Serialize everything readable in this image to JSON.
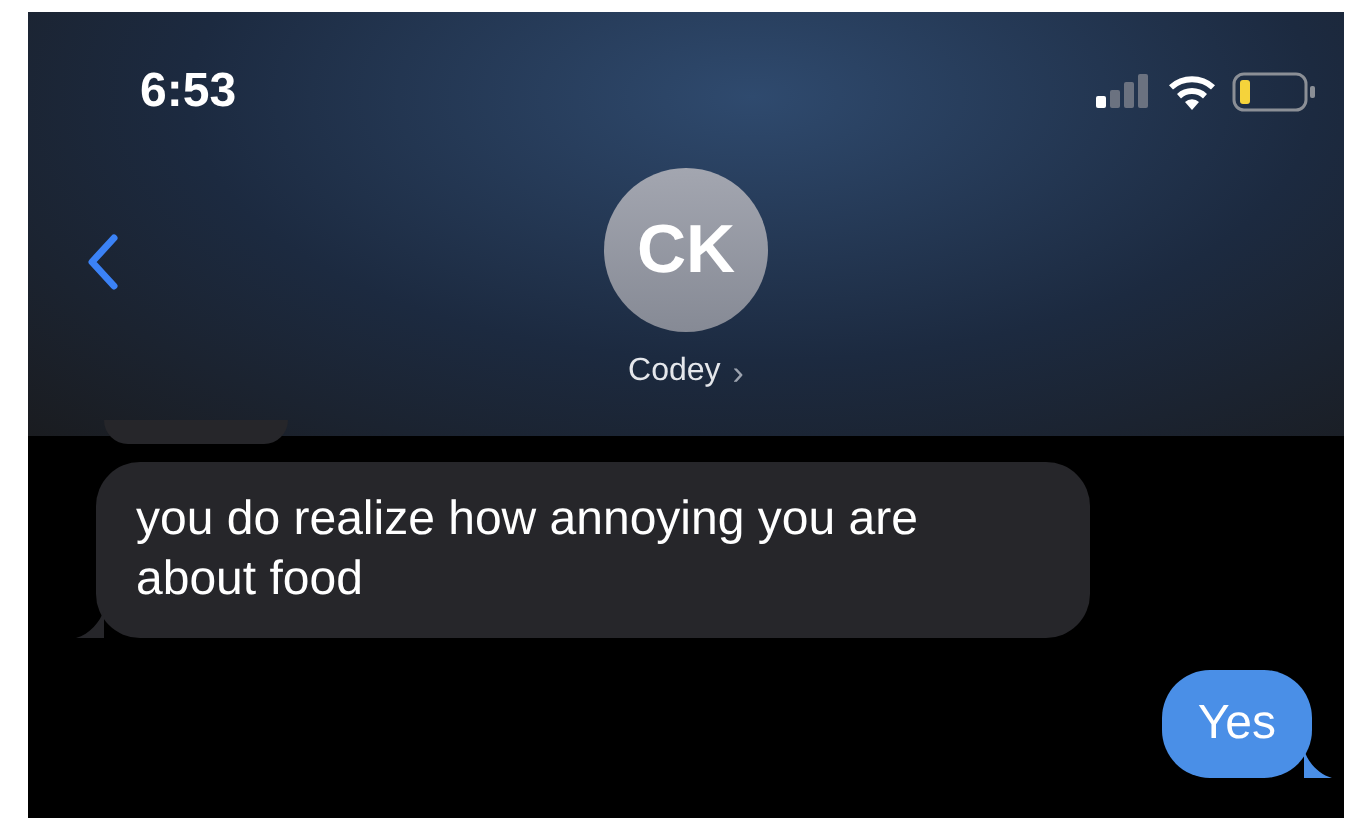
{
  "status_bar": {
    "time": "6:53"
  },
  "contact": {
    "initials": "CK",
    "name": "Codey",
    "chevron": "›"
  },
  "messages": [
    {
      "kind": "incoming",
      "text": "you do realize how annoying you are about food"
    },
    {
      "kind": "outgoing",
      "text": "Yes"
    }
  ]
}
